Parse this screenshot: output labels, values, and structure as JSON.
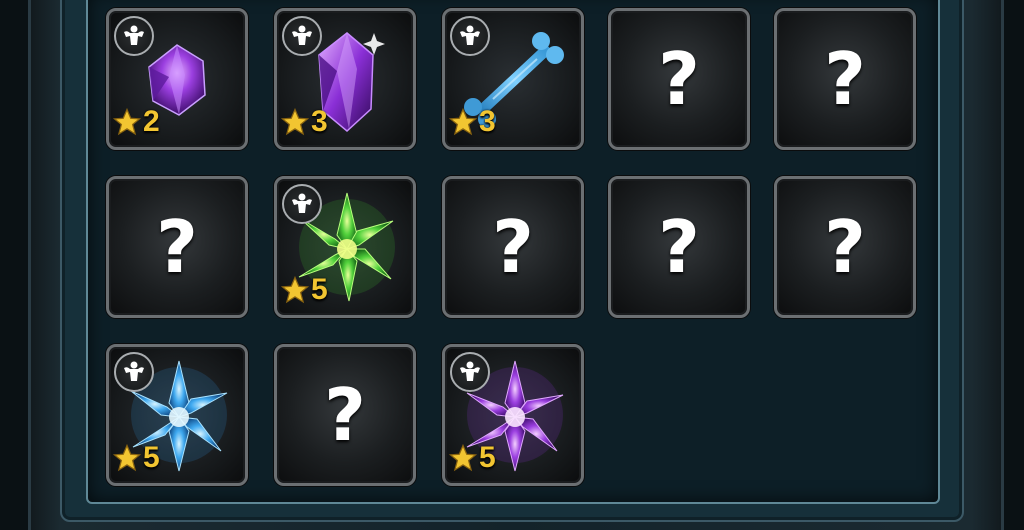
{
  "inventory": {
    "slots": [
      {
        "state": "known",
        "item": "purple-crystal-small",
        "icon": "strength-icon",
        "stars": "2"
      },
      {
        "state": "known",
        "item": "purple-crystal-large",
        "icon": "strength-icon",
        "stars": "3"
      },
      {
        "state": "known",
        "item": "blue-bone",
        "icon": "strength-icon",
        "stars": "3"
      },
      {
        "state": "unknown",
        "mark": "?"
      },
      {
        "state": "unknown",
        "mark": "?"
      },
      {
        "state": "unknown",
        "mark": "?"
      },
      {
        "state": "known",
        "item": "green-crystal-cluster",
        "icon": "strength-icon",
        "stars": "5"
      },
      {
        "state": "unknown",
        "mark": "?"
      },
      {
        "state": "unknown",
        "mark": "?"
      },
      {
        "state": "unknown",
        "mark": "?"
      },
      {
        "state": "known",
        "item": "blue-crystal-cluster",
        "icon": "strength-icon",
        "stars": "5"
      },
      {
        "state": "unknown",
        "mark": "?"
      },
      {
        "state": "known",
        "item": "purple-crystal-cluster",
        "icon": "strength-icon",
        "stars": "5"
      }
    ]
  },
  "colors": {
    "star": "#f2c531",
    "purple": "#9b3fe0",
    "green": "#52d13c",
    "blue": "#3fa9f0",
    "panel_border": "#5f8896"
  }
}
